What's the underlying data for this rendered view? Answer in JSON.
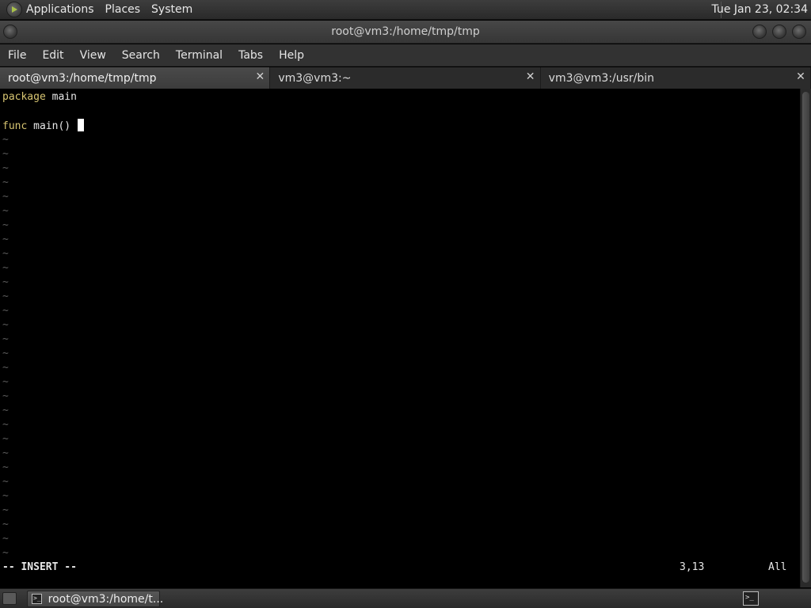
{
  "top_panel": {
    "menus": [
      "Applications",
      "Places",
      "System"
    ],
    "clock": "Tue Jan 23, 02:34"
  },
  "window": {
    "title": "root@vm3:/home/tmp/tmp"
  },
  "menubar": {
    "items": [
      "File",
      "Edit",
      "View",
      "Search",
      "Terminal",
      "Tabs",
      "Help"
    ]
  },
  "tabs": [
    {
      "label": "root@vm3:/home/tmp/tmp",
      "active": true
    },
    {
      "label": "vm3@vm3:~",
      "active": false
    },
    {
      "label": "vm3@vm3:/usr/bin",
      "active": false
    }
  ],
  "editor": {
    "lines": {
      "line1_keyword": "package",
      "line1_rest": " main",
      "line3_keyword": "func",
      "line3_rest": " main() "
    },
    "tilde": "~",
    "mode": "-- INSERT --",
    "position": "3,13",
    "scroll": "All"
  },
  "taskbar": {
    "task_label": "root@vm3:/home/t..."
  },
  "colors": {
    "keyword": "#d7c572",
    "tilde": "#5a5a5a",
    "background": "#000000"
  }
}
